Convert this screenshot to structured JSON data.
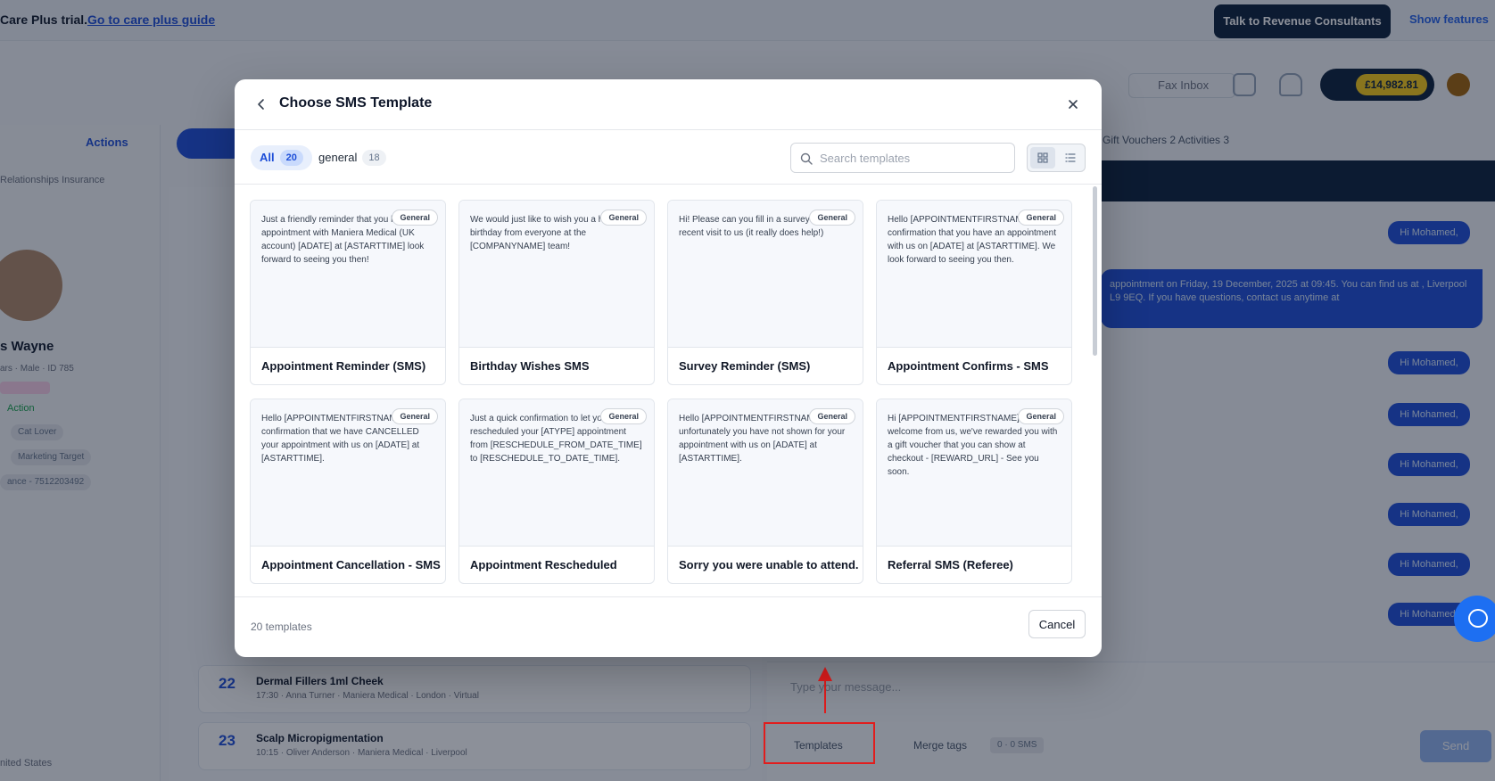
{
  "background": {
    "trial_text": "Care Plus trial.",
    "guide_link": "Go to care plus guide",
    "talk_button": "Talk to Revenue Consultants",
    "features_link": "Show features",
    "fax_inbox": "Fax Inbox",
    "balance": "£14,982.81",
    "actions": "Actions",
    "tabs": "Relationships   Insurance",
    "patient_name": "s Wayne",
    "patient_meta": "ars · Male · ID 785",
    "action_label": "Action",
    "chip_1": "Cat Lover",
    "chip_2": "Marketing Target",
    "chip_3": "ance - 7512203492",
    "footer_text": "nited States",
    "right_tabs": "Gift Vouchers   2       Activities   3",
    "bubble_label": "Hi Mohamed,",
    "bubble_long": "appointment on Friday, 19 December, 2025 at 09:45. You can find us at , Liverpool  L9 9EQ. If you have questions, contact us anytime at ",
    "appointments": [
      {
        "day": "22",
        "title": "Dermal Fillers 1ml Cheek",
        "sub": "17:30 · Anna Turner · Maniera Medical · London · Virtual"
      },
      {
        "day": "23",
        "title": "Scalp Micropigmentation",
        "sub": "10:15 · Oliver Anderson · Maniera Medical · Liverpool"
      }
    ],
    "message_placeholder": "Type your message...",
    "templates_button": "Templates",
    "merge_tags": "Merge tags",
    "sms_count": "0 · 0 SMS",
    "send_button": "Send"
  },
  "modal": {
    "title": "Choose SMS Template",
    "filters": [
      {
        "label": "All",
        "count": "20"
      },
      {
        "label": "general",
        "count": "18"
      }
    ],
    "search_placeholder": "Search templates",
    "cards": [
      {
        "badge": "General",
        "body": "Just a friendly reminder that you have an appointment with Maniera Medical (UK account) [ADATE] at [ASTARTTIME] look forward to seeing you then!",
        "name": "Appointment Reminder (SMS)"
      },
      {
        "badge": "General",
        "body": "We would just like to wish you a happy birthday from everyone at the [COMPANYNAME] team!",
        "name": "Birthday Wishes SMS"
      },
      {
        "badge": "General",
        "body": "Hi! Please can you fill in a survey on your recent visit to us (it really does help!)",
        "name": "Survey Reminder (SMS)"
      },
      {
        "badge": "General",
        "body": "Hello [APPOINTMENTFIRSTNAME], confirmation that you have an appointment with us on [ADATE] at [ASTARTTIME]. We look forward to seeing you then.",
        "name": "Appointment Confirms - SMS"
      },
      {
        "badge": "General",
        "body": "Hello [APPOINTMENTFIRSTNAME], confirmation that we have CANCELLED your appointment with us on [ADATE] at [ASTARTTIME].",
        "name": "Appointment Cancellation - SMS"
      },
      {
        "badge": "General",
        "body": "Just a quick confirmation to let you know we rescheduled your [ATYPE] appointment from [RESCHEDULE_FROM_DATE_TIME] to [RESCHEDULE_TO_DATE_TIME].",
        "name": "Appointment Rescheduled"
      },
      {
        "badge": "General",
        "body": "Hello [APPOINTMENTFIRSTNAME], unfortunately you have not shown for your appointment with us on [ADATE] at [ASTARTTIME].",
        "name": "Sorry you were unable to attend."
      },
      {
        "badge": "General",
        "body": "Hi [APPOINTMENTFIRSTNAME] as a welcome from us, we've rewarded you with a gift voucher that you can show at checkout - [REWARD_URL] - See you soon.",
        "name": "Referral SMS (Referee)"
      }
    ],
    "template_count": "20 templates",
    "cancel_label": "Cancel"
  }
}
